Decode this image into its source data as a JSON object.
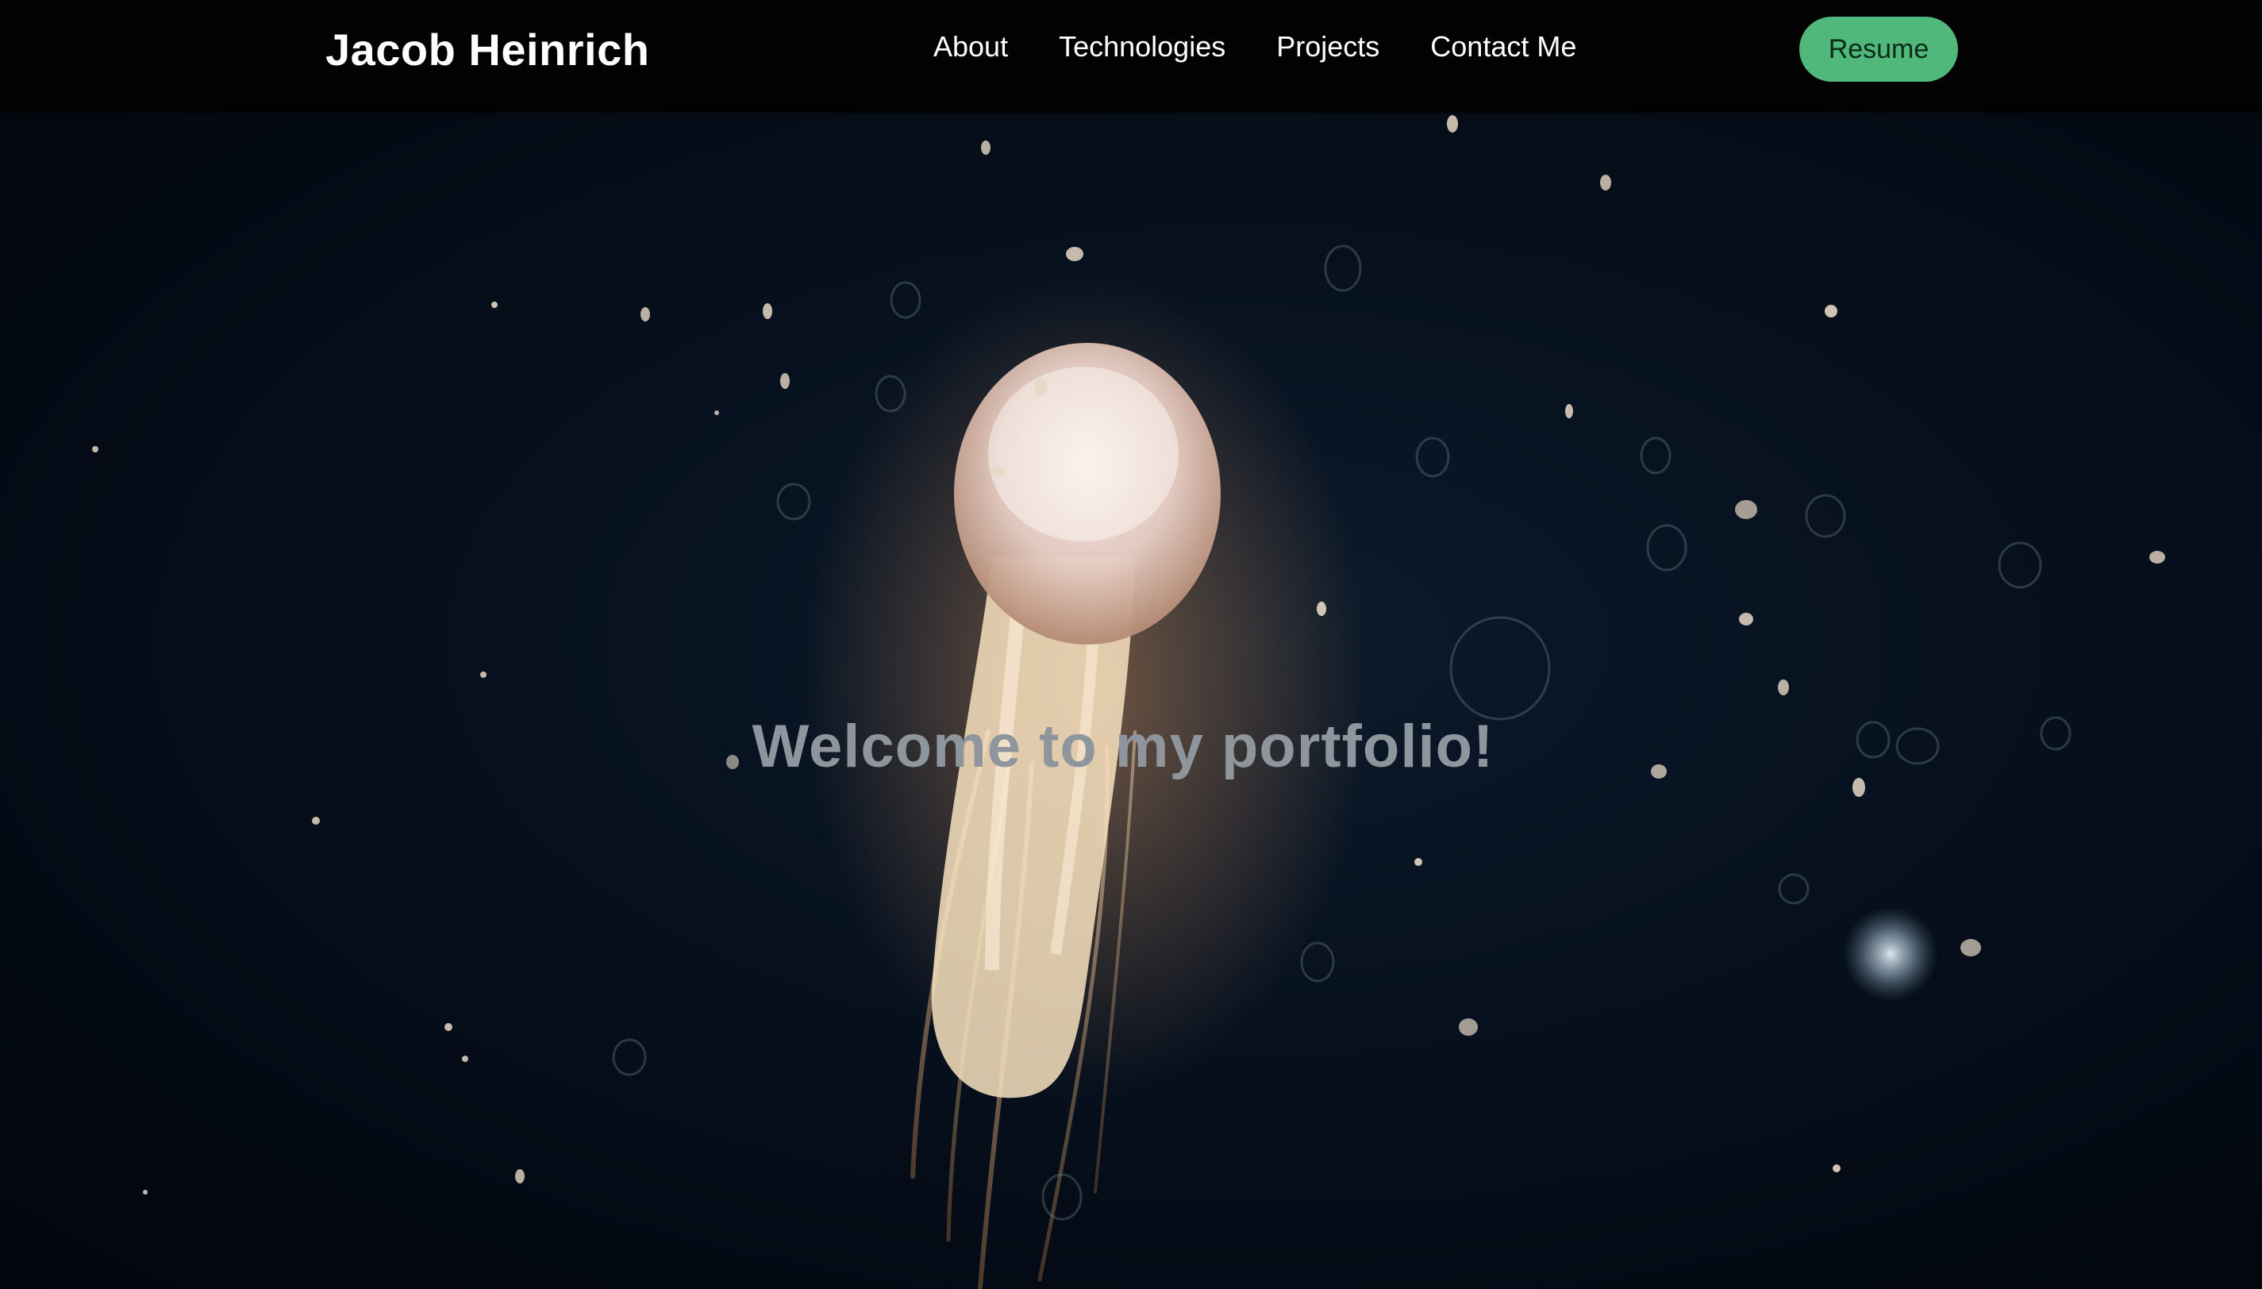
{
  "header": {
    "brand": "Jacob Heinrich",
    "nav_items": [
      "About",
      "Technologies",
      "Projects",
      "Contact Me"
    ],
    "resume_label": "Resume"
  },
  "hero": {
    "title": "Welcome to my portfolio!",
    "background_image": "jellyfish-underwater-photo"
  },
  "colors": {
    "accent": "#4fb87a",
    "nav_bg": "#020202",
    "hero_text": "#8e959c"
  }
}
